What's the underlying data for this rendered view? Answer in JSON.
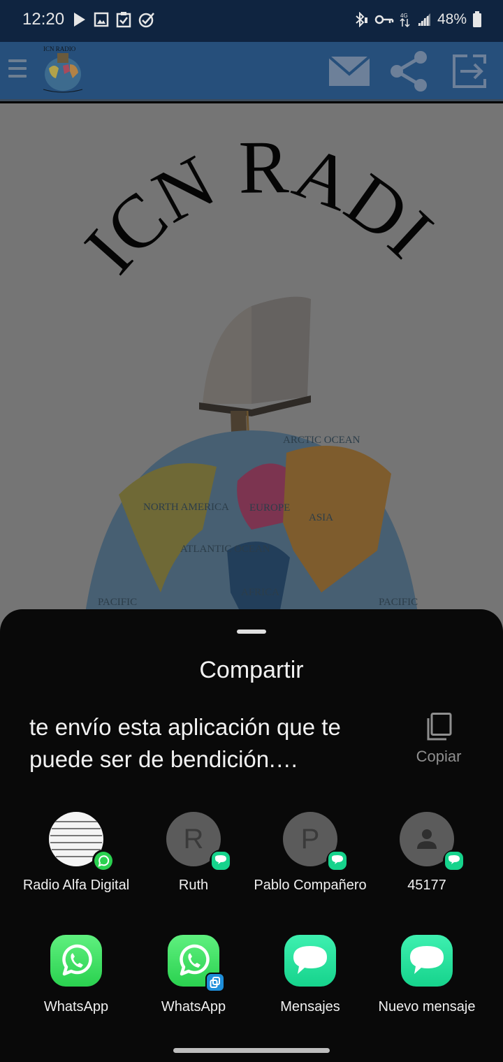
{
  "status_bar": {
    "time": "12:20",
    "battery": "48%",
    "left_icons": [
      "play-icon",
      "image-icon",
      "clipboard-check-icon",
      "check-circle-icon"
    ],
    "right_icons": [
      "bluetooth-icon",
      "vpn-key-icon",
      "data-arrows-icon",
      "signal-icon",
      "battery-icon"
    ]
  },
  "app_bar": {
    "logo_text": "ICN RADIO",
    "actions": [
      "mail-icon",
      "share-icon",
      "exit-icon"
    ]
  },
  "content": {
    "hero_title": "ICN RADIO",
    "map_labels": {
      "arctic": "ARCTIC OCEAN",
      "north_america": "NORTH AMERICA",
      "europe": "EUROPE",
      "asia": "ASIA",
      "atlantic": "ATLANTIC OCEAN",
      "africa": "AFRICA",
      "pacific_left": "PACIFIC",
      "pacific_right": "PACIFIC"
    }
  },
  "share_sheet": {
    "title": "Compartir",
    "text": "te envío esta aplicación que te puede ser de bendición.…",
    "copy_label": "Copiar",
    "direct_targets": [
      {
        "name": "Radio Alfa Digital",
        "initial": "",
        "badge": "whatsapp"
      },
      {
        "name": "Ruth",
        "initial": "R",
        "badge": "messages"
      },
      {
        "name": "Pablo Compañero",
        "initial": "P",
        "badge": "messages"
      },
      {
        "name": "45177",
        "initial": "",
        "badge": "messages"
      }
    ],
    "apps": [
      {
        "name": "WhatsApp",
        "icon": "whatsapp-icon"
      },
      {
        "name": "WhatsApp",
        "icon": "whatsapp-clone-icon"
      },
      {
        "name": "Mensajes",
        "icon": "messages-icon"
      },
      {
        "name": "Nuevo mensaje",
        "icon": "messages-icon"
      }
    ]
  },
  "colors": {
    "status_bar": "#0f2440",
    "app_bar": "#264f7b",
    "sheet_bg": "#090909",
    "whatsapp": "#2ad14f",
    "messages": "#16d38c"
  }
}
